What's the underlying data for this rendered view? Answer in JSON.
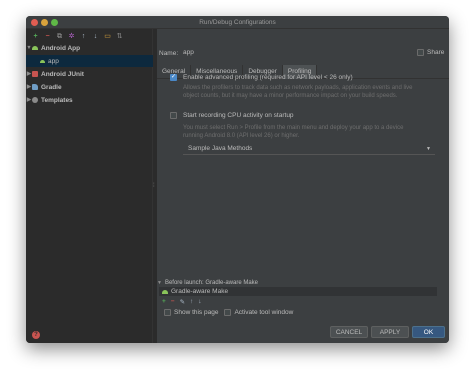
{
  "window": {
    "title": "Run/Debug Configurations"
  },
  "toolbar": {
    "icons": [
      "add-icon",
      "remove-icon",
      "copy-icon",
      "settings-icon",
      "move-up-icon",
      "move-down-icon",
      "folder-icon",
      "sort-icon"
    ],
    "glyphs": {
      "add": "+",
      "remove": "−",
      "copy": "⧉",
      "gear": "✲",
      "up": "↑",
      "down": "↓",
      "folder": "▭",
      "sort": "⇅"
    }
  },
  "tree": {
    "android_app": "Android App",
    "app": "app",
    "android_junit": "Android JUnit",
    "gradle": "Gradle",
    "templates": "Templates"
  },
  "form": {
    "name_label": "Name:",
    "name_value": "app",
    "share_label": "Share",
    "share_checked": false
  },
  "tabs": [
    {
      "label": "General",
      "active": false
    },
    {
      "label": "Miscellaneous",
      "active": false
    },
    {
      "label": "Debugger",
      "active": false
    },
    {
      "label": "Profiling",
      "active": true
    }
  ],
  "profiling": {
    "advanced_label": "Enable advanced profiling (required for API level < 26 only)",
    "advanced_checked": true,
    "advanced_help": "Allows the profilers to track data such as network payloads, application events and live object counts, but it may have a minor performance impact on your build speeds.",
    "cpu_label": "Start recording CPU activity on startup",
    "cpu_checked": false,
    "cpu_help": "You must select Run > Profile from the main menu and deploy your app to a device running Android 8.0 (API level 26) or higher.",
    "method": "Sample Java Methods"
  },
  "before_launch": {
    "label": "Before launch: Gradle-aware Make",
    "task": "Gradle-aware Make"
  },
  "task_toolbar": {
    "add": "+",
    "remove": "−",
    "edit": "✎",
    "up": "↑",
    "down": "↓"
  },
  "options": {
    "show_page_label": "Show this page",
    "show_page_checked": false,
    "tool_window_label": "Activate tool window",
    "tool_window_checked": false
  },
  "buttons": {
    "cancel": "CANCEL",
    "apply": "APPLY",
    "ok": "OK"
  },
  "colors": {
    "accent": "#365880",
    "selection": "#0d293e",
    "panel": "#3c3f41",
    "sidebar": "#2b2b2b"
  }
}
